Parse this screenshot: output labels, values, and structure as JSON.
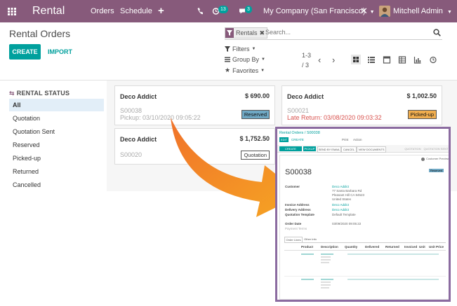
{
  "navbar": {
    "app_name": "Rental",
    "menu": [
      "Orders",
      "Schedule"
    ],
    "activity_count": "13",
    "message_count": "3",
    "company": "My Company (San Francisco)",
    "user": "Mitchell Admin"
  },
  "control": {
    "title": "Rental Orders",
    "create_label": "CREATE",
    "import_label": "IMPORT",
    "facet_label": "Rentals",
    "search_placeholder": "Search...",
    "filters_label": "Filters",
    "groupby_label": "Group By",
    "favorites_label": "Favorites",
    "pager_range": "1-3",
    "pager_total": "/ 3"
  },
  "side_panel": {
    "heading": "RENTAL STATUS",
    "items": [
      "All",
      "Quotation",
      "Quotation Sent",
      "Reserved",
      "Picked-up",
      "Returned",
      "Cancelled"
    ]
  },
  "cards": [
    {
      "customer": "Deco Addict",
      "amount": "$ 690.00",
      "ref": "S00038",
      "date": "Pickup: 03/10/2020 09:05:22",
      "status": "Reserved"
    },
    {
      "customer": "Deco Addict",
      "amount": "$ 1,002.50",
      "ref": "S00021",
      "date": "Late Return: 03/08/2020 09:03:32",
      "status": "Picked-up"
    },
    {
      "customer": "Deco Addict",
      "amount": "$ 1,752.50",
      "ref": "S00020",
      "date": "",
      "status": "Quotation"
    }
  ],
  "inset": {
    "breadcrumb": "Rental Orders / S00038",
    "edit": "EDIT",
    "create": "CREATE",
    "print": "Print",
    "action": "Action",
    "buttons": [
      "CREATE INVOICE",
      "PICKUP",
      "SEND BY EMAIL",
      "CANCEL",
      "VIEW DOCUMENTS"
    ],
    "stages": [
      "QUOTATION",
      "QUOTATION SENT"
    ],
    "preview": "Customer Preview",
    "badge": "Reserved",
    "order_name": "S00038",
    "customer_label": "Customer",
    "customer_value": "Deco Addict",
    "address": [
      "77 Santa Barbara Rd",
      "Pleasant Hill CA 94523",
      "United States"
    ],
    "invoice_label": "Invoice Address",
    "invoice_value": "Deco Addict",
    "delivery_label": "Delivery Address",
    "delivery_value": "Deco Addict",
    "template_label": "Quotation Template",
    "template_value": "Default Template",
    "order_date_label": "Order Date",
    "order_date_value": "03/09/2020 09:05:22",
    "payment_terms_label": "Payment Terms",
    "tabs": [
      "Order Lines",
      "Other Info"
    ],
    "columns": [
      "Product",
      "Description",
      "Quantity",
      "Delivered",
      "Returned",
      "Invoiced",
      "Unit",
      "Unit Price"
    ]
  },
  "colors": {
    "brand": "#875A7B",
    "accent": "#00A09D",
    "reserved_badge": "#6fa8c4",
    "pickedup_badge": "#f0ad4e",
    "late": "#d9534f"
  }
}
